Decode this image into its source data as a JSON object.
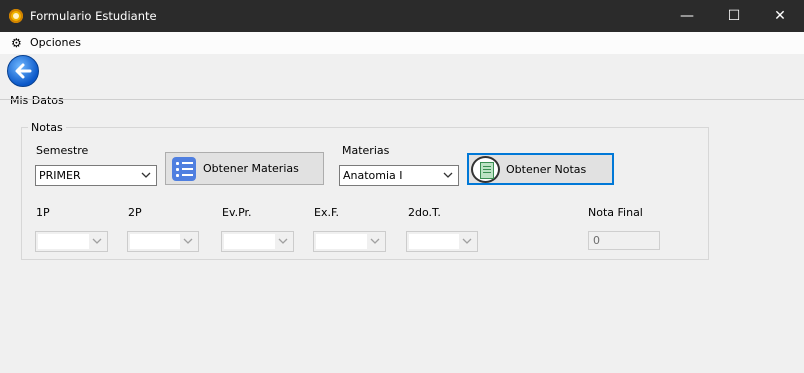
{
  "window": {
    "title": "Formulario Estudiante",
    "controls": {
      "minimize": "—",
      "maximize": "☐",
      "close": "✕"
    }
  },
  "menu": {
    "options_label": "Opciones"
  },
  "section": {
    "label": "Mis Datos"
  },
  "notas_group": {
    "legend": "Notas",
    "semestre_label": "Semestre",
    "semestre_value": "PRIMER",
    "obtener_materias_label": "Obtener Materias",
    "materias_label": "Materias",
    "materias_value": "Anatomia I",
    "obtener_notas_label": "Obtener Notas",
    "grade_labels": [
      "1P",
      "2P",
      "Ev.Pr.",
      "Ex.F.",
      "2do.T."
    ],
    "nota_final_label": "Nota Final",
    "nota_final_value": "0"
  }
}
